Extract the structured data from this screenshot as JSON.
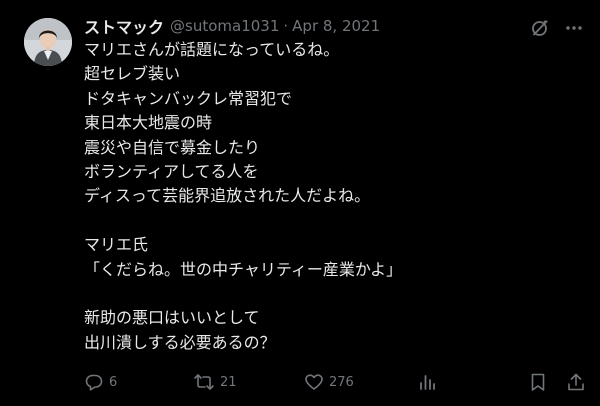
{
  "tweet": {
    "author": {
      "display_name": "ストマック",
      "handle": "@sutoma1031"
    },
    "separator": "·",
    "date": "Apr 8, 2021",
    "text_lines": [
      "マリエさんが話題になっているね。",
      "超セレブ装い",
      "ドタキャンバックレ常習犯で",
      "東日本大地震の時",
      "震災や自信で募金したり",
      "ボランティアしてる人を",
      "ディスって芸能界追放された人だよね。",
      "",
      "マリエ氏",
      "「くだらね。世の中チャリティー産業かよ」",
      "",
      "新助の悪口はいいとして",
      "出川潰しする必要あるの？"
    ],
    "stats": {
      "replies": "6",
      "retweets": "21",
      "likes": "276"
    }
  },
  "colors": {
    "background": "#000000",
    "text_primary": "#e7e9ea",
    "text_secondary": "#71767b"
  },
  "icons": {
    "header": [
      "grok-icon",
      "more-icon"
    ],
    "actions": [
      "reply-icon",
      "retweet-icon",
      "like-icon",
      "views-icon",
      "bookmark-icon",
      "share-icon"
    ]
  }
}
